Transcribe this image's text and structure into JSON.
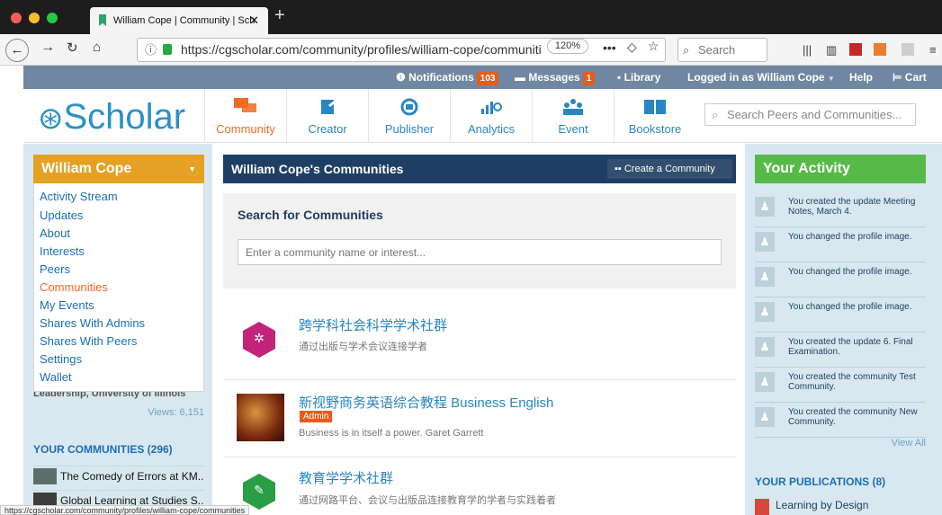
{
  "browser": {
    "tab_title": "William Cope | Community | Sch",
    "url": "https://cgscholar.com/community/profiles/william-cope/communiti",
    "zoom": "120%",
    "search_placeholder": "Search",
    "status_url": "https://cgscholar.com/community/profiles/william-cope/communities"
  },
  "topbar": {
    "notifications_label": "Notifications",
    "notifications_count": "103",
    "messages_label": "Messages",
    "messages_count": "1",
    "library_label": "Library",
    "logged_in": "Logged in as William Cope",
    "help": "Help",
    "cart": "Cart"
  },
  "header": {
    "logo": "Scholar",
    "nav": [
      "Community",
      "Creator",
      "Publisher",
      "Analytics",
      "Event",
      "Bookstore"
    ],
    "search_placeholder": "Search Peers and Communities..."
  },
  "left": {
    "user_name": "William Cope",
    "menu": [
      "Activity Stream",
      "Updates",
      "About",
      "Interests",
      "Peers",
      "Communities",
      "My Events",
      "Shares With Admins",
      "Shares With Peers",
      "Settings",
      "Wallet"
    ],
    "active_index": 5,
    "behind_text": "Leadership, University of Illinois",
    "views": "Views: 6,151",
    "your_communities": "YOUR COMMUNITIES (296)",
    "communities": [
      "The Comedy of Errors at KM...",
      "Global Learning at Studies S..."
    ]
  },
  "main": {
    "header_title": "William Cope's Communities",
    "create_label": "Create a Community",
    "search_title": "Search for Communities",
    "search_placeholder": "Enter a community name or interest...",
    "items": [
      {
        "title": "跨学科社会科学学术社群",
        "desc": "通过出版与学术会议连接学者",
        "badge": ""
      },
      {
        "title": "新视野商务英语综合教程 Business English",
        "desc": "Business is in itself a power. Garet Garrett",
        "badge": "Admin"
      },
      {
        "title": "教育学学术社群",
        "desc": "通过网路平台、会议与出版品连接教育学的学者与实践着者",
        "badge": ""
      }
    ]
  },
  "right": {
    "activity_title": "Your Activity",
    "activities": [
      "You created the update Meeting Notes, March 4.",
      "You changed the profile image.",
      "You changed the profile image.",
      "You changed the profile image.",
      "You created the update 6. Final Examination.",
      "You created the community Test Community.",
      "You created the community New Community."
    ],
    "view_all": "View All",
    "publications_title": "YOUR PUBLICATIONS (8)",
    "publication": "Learning by Design"
  }
}
